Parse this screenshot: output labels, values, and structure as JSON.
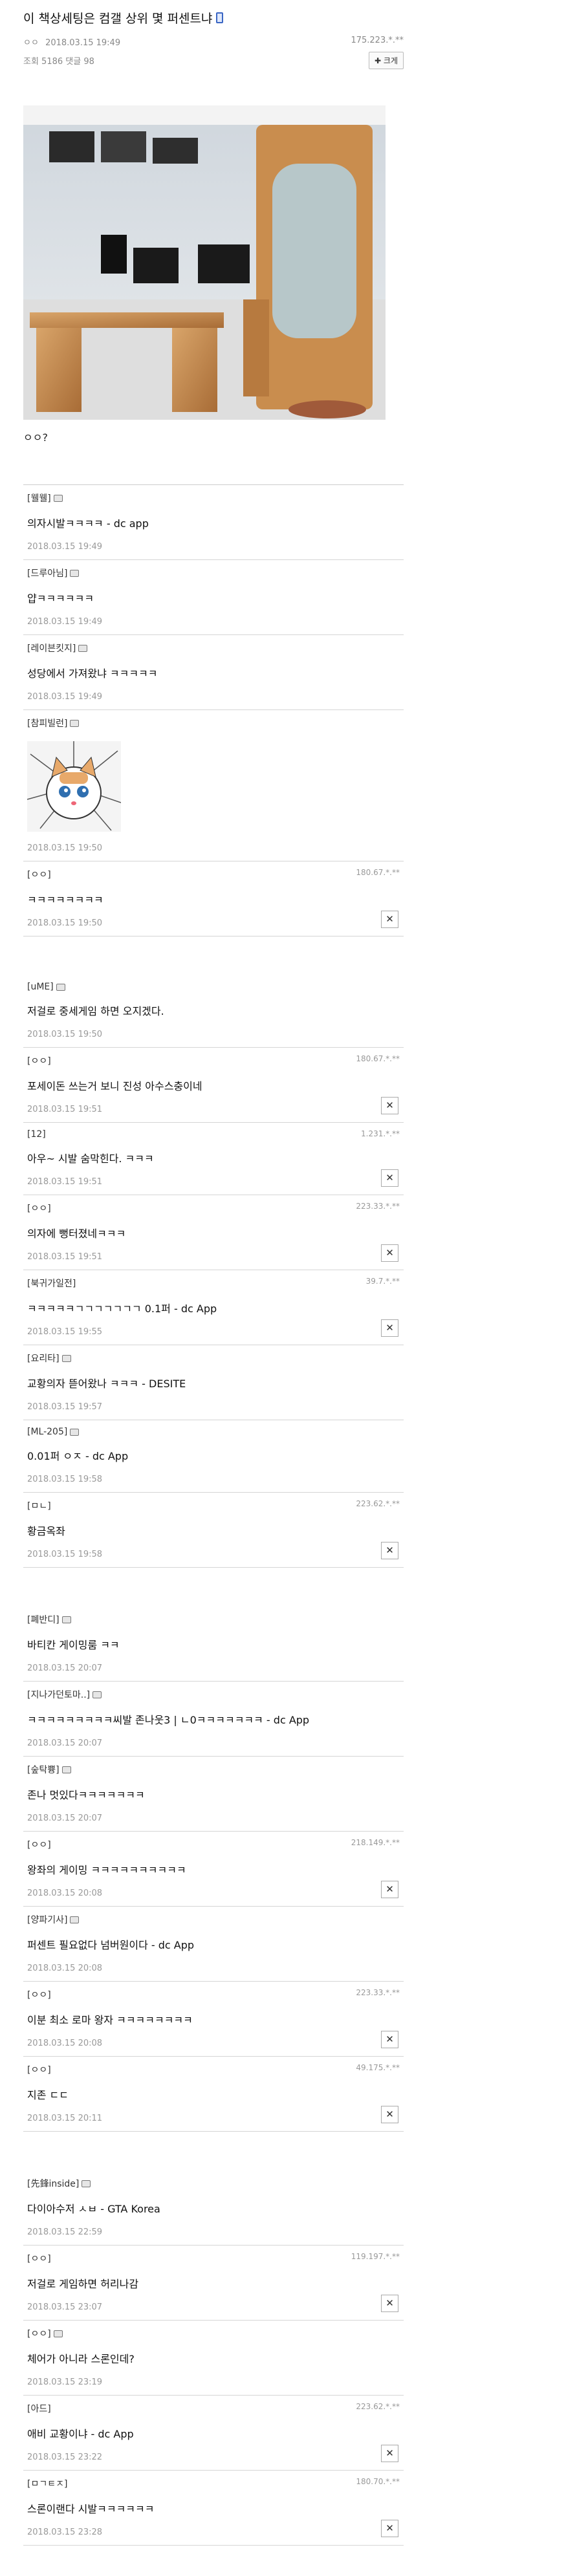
{
  "post": {
    "title": "이 책상세팅은 컴갤 상위 몇 퍼센트냐",
    "author": "ㅇㅇ",
    "datetime": "2018.03.15 19:49",
    "ip": "175.223.*.**",
    "stats": "조회 5186  댓글 98",
    "enlarge_label": "✚ 크게",
    "body": "ㅇㅇ?"
  },
  "comments": [
    {
      "name": "[웰웰]",
      "gallog": true,
      "ip": "",
      "text": "의자시발ㅋㅋㅋㅋ - dc app",
      "date": "2018.03.15 19:49",
      "delete": false
    },
    {
      "name": "[드루아님]",
      "gallog": true,
      "ip": "",
      "text": "얍ㅋㅋㅋㅋㅋㅋ",
      "date": "2018.03.15 19:49",
      "delete": false
    },
    {
      "name": "[레이븐킷지]",
      "gallog": true,
      "ip": "",
      "text": "성당에서 가져왔냐 ㅋㅋㅋㅋㅋ",
      "date": "2018.03.15 19:49",
      "delete": false
    },
    {
      "name": "[참피빌런]",
      "gallog": true,
      "ip": "",
      "text": "",
      "sticker": true,
      "date": "2018.03.15 19:50",
      "delete": false
    },
    {
      "name": "[ㅇㅇ]",
      "gallog": false,
      "ip": "180.67.*.**",
      "text": "ㅋㅋㅋㅋㅋㅋㅋㅋ",
      "date": "2018.03.15 19:50",
      "delete": true,
      "gap": true
    },
    {
      "name": "[uME]",
      "gallog": true,
      "ip": "",
      "text": "저걸로 중세게임 하면 오지겠다.",
      "date": "2018.03.15 19:50",
      "delete": false
    },
    {
      "name": "[ㅇㅇ]",
      "gallog": false,
      "ip": "180.67.*.**",
      "text": "포세이돈 쓰는거 보니 진성 아수스충이네",
      "date": "2018.03.15 19:51",
      "delete": true
    },
    {
      "name": "[12]",
      "gallog": false,
      "ip": "1.231.*.**",
      "text": "아우~ 시발 숨막힌다. ㅋㅋㅋ",
      "date": "2018.03.15 19:51",
      "delete": true
    },
    {
      "name": "[ㅇㅇ]",
      "gallog": false,
      "ip": "223.33.*.**",
      "text": "의자에 뻥터졌네ㅋㅋㅋ",
      "date": "2018.03.15 19:51",
      "delete": true
    },
    {
      "name": "[북귀가일전]",
      "gallog": false,
      "ip": "39.7.*.**",
      "text": "ㅋㅋㅋㅋㅋㄱㄱㄱㄱㄱㄱㄱ 0.1퍼 - dc App",
      "date": "2018.03.15 19:55",
      "delete": true
    },
    {
      "name": "[요리타]",
      "gallog": true,
      "ip": "",
      "text": "교황의자 뜯어왔나 ㅋㅋㅋ - DESITE",
      "date": "2018.03.15 19:57",
      "delete": false
    },
    {
      "name": "[ML-205]",
      "gallog": true,
      "ip": "",
      "text": "0.01퍼 ㅇㅈ - dc App",
      "date": "2018.03.15 19:58",
      "delete": false
    },
    {
      "name": "[ㅁㄴ]",
      "gallog": false,
      "ip": "223.62.*.**",
      "text": "황금옥좌",
      "date": "2018.03.15 19:58",
      "delete": true,
      "gap": true
    },
    {
      "name": "[폐반디]",
      "gallog": true,
      "ip": "",
      "text": "바티칸 게이밍룸 ㅋㅋ",
      "date": "2018.03.15 20:07",
      "delete": false
    },
    {
      "name": "[지나가던토마..]",
      "gallog": true,
      "ip": "",
      "text": "ㅋㅋㅋㅋㅋㅋㅋㅋㅋ씨발 존나웃3 | ㄴ0ㅋㅋㅋㅋㅋㅋㅋ - dc App",
      "date": "2018.03.15 20:07",
      "delete": false
    },
    {
      "name": "[숲탁쁑]",
      "gallog": true,
      "ip": "",
      "text": "존나 멋있다ㅋㅋㅋㅋㅋㅋㅋ",
      "date": "2018.03.15 20:07",
      "delete": false
    },
    {
      "name": "[ㅇㅇ]",
      "gallog": false,
      "ip": "218.149.*.**",
      "text": "왕좌의 게이밍 ㅋㅋㅋㅋㅋㅋㅋㅋㅋㅋ",
      "date": "2018.03.15 20:08",
      "delete": true
    },
    {
      "name": "[양파기사]",
      "gallog": true,
      "ip": "",
      "text": "퍼센트 필요없다 넘버원이다 - dc App",
      "date": "2018.03.15 20:08",
      "delete": false
    },
    {
      "name": "[ㅇㅇ]",
      "gallog": false,
      "ip": "223.33.*.**",
      "text": "이분 최소 로마 왕자 ㅋㅋㅋㅋㅋㅋㅋㅋ",
      "date": "2018.03.15 20:08",
      "delete": true
    },
    {
      "name": "[ㅇㅇ]",
      "gallog": false,
      "ip": "49.175.*.**",
      "text": "지존 ㄷㄷ",
      "date": "2018.03.15 20:11",
      "delete": true,
      "gap": true
    },
    {
      "name": "[先鋒inside]",
      "gallog": true,
      "ip": "",
      "text": "다이아수저 ㅅㅂ - GTA Korea",
      "date": "2018.03.15 22:59",
      "delete": false
    },
    {
      "name": "[ㅇㅇ]",
      "gallog": false,
      "ip": "119.197.*.**",
      "text": "저걸로 게임하면 허리나감",
      "date": "2018.03.15 23:07",
      "delete": true
    },
    {
      "name": "[ㅇㅇ]",
      "gallog": true,
      "ip": "",
      "text": "체어가 아니라 스론인데?",
      "date": "2018.03.15 23:19",
      "delete": false
    },
    {
      "name": "[아드]",
      "gallog": false,
      "ip": "223.62.*.**",
      "text": "애비 교황이냐 - dc App",
      "date": "2018.03.15 23:22",
      "delete": true
    },
    {
      "name": "[ㅁㄱㅌㅈ]",
      "gallog": false,
      "ip": "180.70.*.**",
      "text": "스론이랜다 시발ㅋㅋㅋㅋㅋㅋ",
      "date": "2018.03.15 23:28",
      "delete": true
    }
  ],
  "icons": {
    "delete": "close-icon",
    "gallog": "gallog-icon",
    "mobile": "mobile-icon"
  },
  "colors": {
    "accent": "#3a66c4",
    "border": "#d5d5d5",
    "muted": "#999999"
  }
}
